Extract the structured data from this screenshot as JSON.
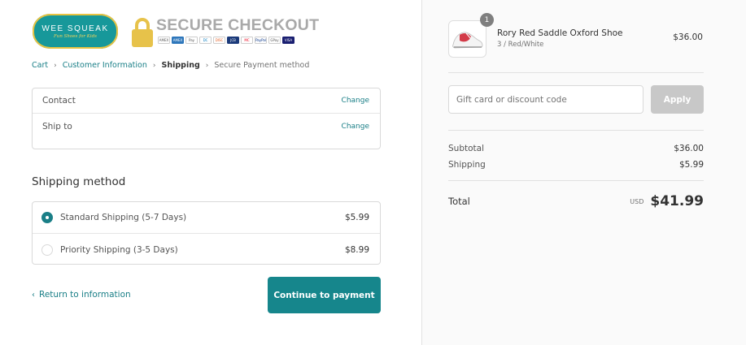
{
  "header": {
    "brand_name": "WEE SQUEAK",
    "brand_tagline": "Fun Shoes for Kids",
    "secure_title": "SECURE CHECKOUT",
    "payment_cards": [
      "AMEX",
      "AMEX",
      "Pay",
      "DC",
      "DISC",
      "JCB",
      "MC",
      "PayPal",
      "GPay",
      "VISA"
    ]
  },
  "breadcrumb": {
    "items": [
      {
        "label": "Cart",
        "state": "link"
      },
      {
        "label": "Customer Information",
        "state": "link"
      },
      {
        "label": "Shipping",
        "state": "current"
      },
      {
        "label": "Secure Payment method",
        "state": "upcoming"
      }
    ],
    "separator": "›"
  },
  "review": {
    "contact_label": "Contact",
    "contact_change": "Change",
    "shipto_label": "Ship to",
    "shipto_change": "Change"
  },
  "shipping": {
    "title": "Shipping method",
    "options": [
      {
        "label": "Standard Shipping (5-7 Days)",
        "price": "$5.99",
        "selected": true
      },
      {
        "label": "Priority Shipping (3-5 Days)",
        "price": "$8.99",
        "selected": false
      }
    ]
  },
  "actions": {
    "return_label": "Return to information",
    "continue_label": "Continue to payment"
  },
  "summary": {
    "product": {
      "name": "Rory Red Saddle Oxford Shoe",
      "variant": "3 / Red/White",
      "price": "$36.00",
      "quantity": "1"
    },
    "discount_placeholder": "Gift card or discount code",
    "apply_label": "Apply",
    "subtotal_label": "Subtotal",
    "subtotal_value": "$36.00",
    "shipping_label": "Shipping",
    "shipping_value": "$5.99",
    "total_label": "Total",
    "currency": "USD",
    "total_value": "$41.99"
  },
  "colors": {
    "accent": "#1a7f87",
    "button": "#16868c",
    "apply_disabled": "#c8c8c8",
    "brand_teal": "#17989a",
    "brand_gold": "#e7c24a"
  }
}
